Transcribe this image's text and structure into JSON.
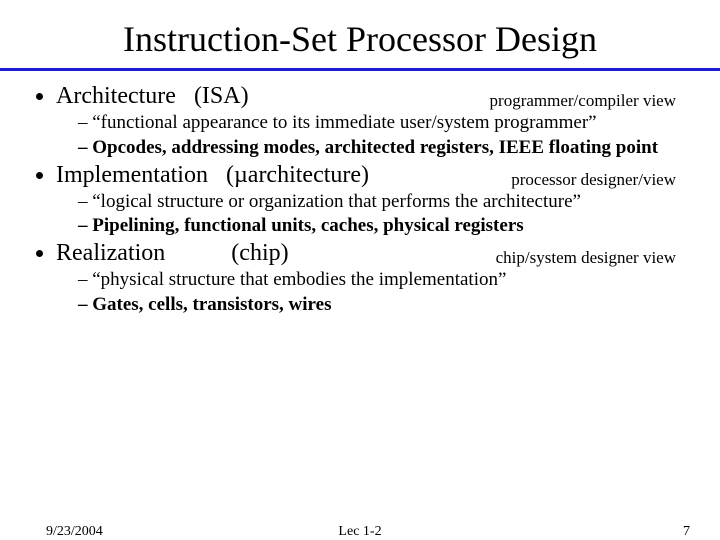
{
  "title": "Instruction-Set Processor Design",
  "sections": [
    {
      "label": "Architecture",
      "paren": "(ISA)",
      "view": "programmer/compiler view",
      "subs": [
        {
          "text": "“functional appearance to its immediate user/system programmer”",
          "bold": false
        },
        {
          "text": "Opcodes, addressing modes, architected registers, IEEE floating point",
          "bold": true
        }
      ]
    },
    {
      "label": "Implementation",
      "paren": "(µarchitecture)",
      "view": "processor designer/view",
      "subs": [
        {
          "text": "“logical structure or organization that performs the architecture”",
          "bold": false
        },
        {
          "text": "Pipelining, functional units, caches, physical registers",
          "bold": true
        }
      ]
    },
    {
      "label": "Realization",
      "paren": "(chip)",
      "view": "chip/system designer view",
      "subs": [
        {
          "text": "“physical structure that embodies the implementation”",
          "bold": false
        },
        {
          "text": "Gates, cells, transistors, wires",
          "bold": true
        }
      ]
    }
  ],
  "footer": {
    "date": "9/23/2004",
    "lec": "Lec 1-2",
    "page": "7"
  }
}
